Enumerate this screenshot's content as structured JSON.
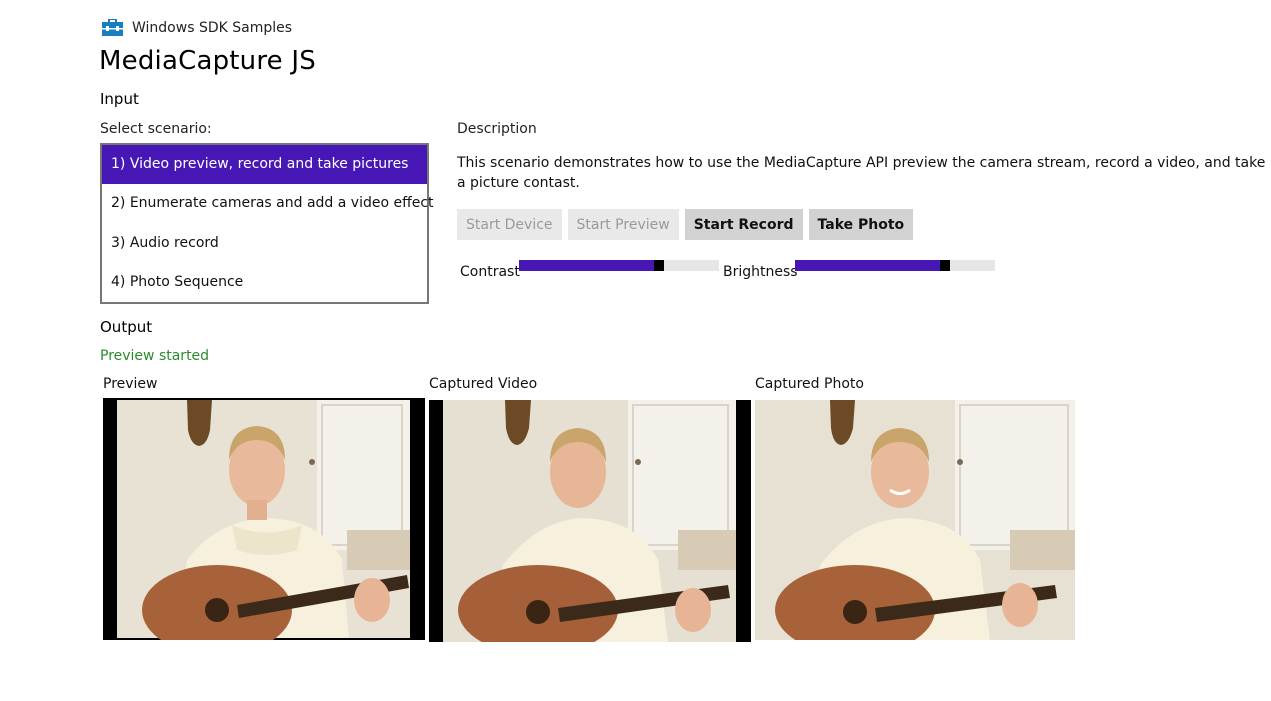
{
  "header": {
    "sdk_title": "Windows SDK Samples",
    "sdk_icon": "toolbox-icon",
    "app_title": "MediaCapture JS"
  },
  "input": {
    "label": "Input",
    "select_label": "Select scenario:",
    "scenarios": [
      "1) Video preview, record and take pictures",
      "2) Enumerate cameras and add a video effect",
      "3) Audio record",
      "4) Photo Sequence"
    ],
    "selected_index": 0
  },
  "description": {
    "label": "Description",
    "text": "This scenario demonstrates how to use the MediaCapture API preview the camera stream, record a video, and take a picture contast."
  },
  "buttons": {
    "start_device": "Start Device",
    "start_preview": "Start Preview",
    "start_record": "Start Record",
    "take_photo": "Take Photo"
  },
  "sliders": {
    "contrast_label": "Contrast",
    "contrast_value": 0.7,
    "brightness_label": "Brightness",
    "brightness_value": 0.75
  },
  "output": {
    "label": "Output",
    "status": "Preview started",
    "preview_label": "Preview",
    "video_label": "Captured Video",
    "photo_label": "Captured Photo"
  },
  "colors": {
    "accent": "#4617b4",
    "status_green": "#2c8a2c",
    "button_disabled": "#e9e9e9",
    "button_enabled": "#d2d2d2"
  }
}
